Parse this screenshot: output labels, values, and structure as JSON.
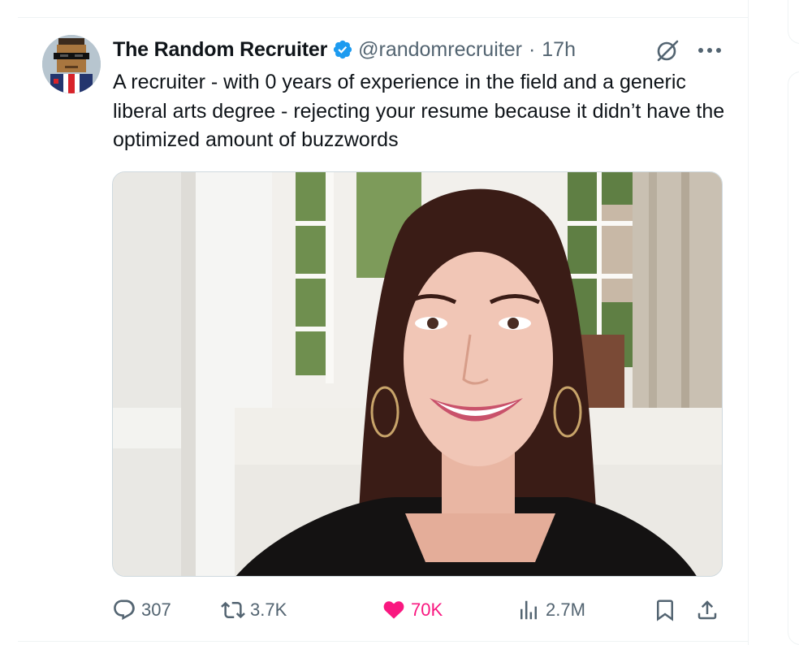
{
  "tweet": {
    "display_name": "The Random Recruiter",
    "handle": "@randomrecruiter",
    "separator": "·",
    "time": "17h",
    "text": "A recruiter - with 0 years of experience in the field and a generic liberal arts degree - rejecting your resume because it didn’t have the optimized amount of buzzwords",
    "verified": true
  },
  "actions": {
    "replies": "307",
    "retweets": "3.7K",
    "likes": "70K",
    "views": "2.7M"
  },
  "icons": {
    "avatar": "pixel-man-with-sunglasses",
    "verified": "verified-badge-icon",
    "grok": "grok-icon",
    "more": "more-icon",
    "reply": "reply-icon",
    "retweet": "retweet-icon",
    "like": "heart-icon",
    "views": "views-icon",
    "bookmark": "bookmark-icon",
    "share": "share-icon"
  },
  "colors": {
    "text_primary": "#0f1419",
    "text_secondary": "#536471",
    "verified_blue": "#1d9bf0",
    "like_pink": "#f91880"
  }
}
